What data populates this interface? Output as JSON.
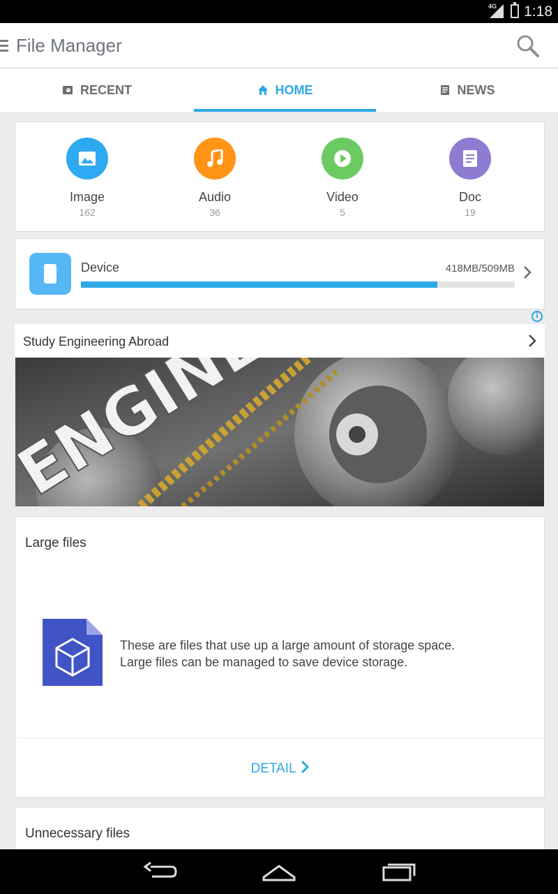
{
  "status_bar": {
    "network": "4G",
    "time": "1:18"
  },
  "app_bar": {
    "title": "File Manager"
  },
  "tabs": [
    {
      "label": "RECENT",
      "icon": "recent-icon"
    },
    {
      "label": "HOME",
      "icon": "home-icon",
      "active": true
    },
    {
      "label": "NEWS",
      "icon": "news-icon"
    }
  ],
  "categories": [
    {
      "label": "Image",
      "count": "162",
      "color": "#2FA9F1",
      "icon": "image-icon"
    },
    {
      "label": "Audio",
      "count": "36",
      "color": "#FF9416",
      "icon": "music-note-icon"
    },
    {
      "label": "Video",
      "count": "5",
      "color": "#6BCB62",
      "icon": "play-icon"
    },
    {
      "label": "Doc",
      "count": "19",
      "color": "#8E7CD3",
      "icon": "document-icon"
    }
  ],
  "storage": {
    "label": "Device",
    "size_text": "418MB/509MB",
    "used_fraction": 0.821
  },
  "ad": {
    "title": "Study Engineering Abroad"
  },
  "large_files": {
    "title": "Large files",
    "description_line1": "These are files that use up a large amount of storage space.",
    "description_line2": "Large files can be managed to save device storage.",
    "detail_label": "DETAIL"
  },
  "unnecessary_files": {
    "title": "Unnecessary files"
  },
  "colors": {
    "accent": "#2BA8E6",
    "background": "#ECEBEE"
  }
}
